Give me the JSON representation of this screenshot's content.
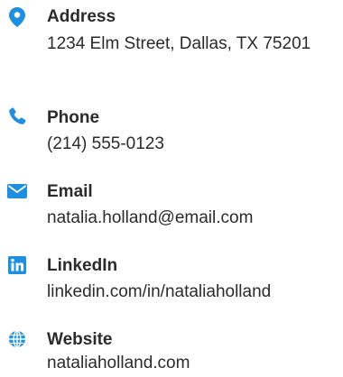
{
  "accent_color": "#1f8fe0",
  "contact": {
    "address": {
      "icon": "location-pin-icon",
      "label": "Address",
      "value": "1234 Elm Street, Dallas, TX 75201"
    },
    "phone": {
      "icon": "phone-icon",
      "label": "Phone",
      "value": "(214) 555-0123"
    },
    "email": {
      "icon": "envelope-icon",
      "label": "Email",
      "value": "natalia.holland@email.com"
    },
    "linkedin": {
      "icon": "linkedin-icon",
      "label": "LinkedIn",
      "value": "linkedin.com/in/nataliaholland"
    },
    "website": {
      "icon": "globe-icon",
      "label": "Website",
      "value": "nataliaholland.com"
    }
  }
}
